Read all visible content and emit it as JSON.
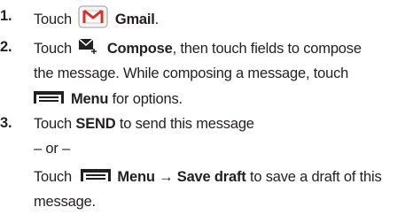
{
  "steps": [
    {
      "number": "1.",
      "text_before": "Touch",
      "bold": "Gmail",
      "text_after": "."
    },
    {
      "number": "2.",
      "line1_before": "Touch",
      "line1_bold": "Compose",
      "line1_after": ", then touch fields to compose",
      "line2": "the message. While composing a message, touch",
      "line3_bold": "Menu",
      "line3_after": "for options."
    },
    {
      "number": "3.",
      "line1_before": "Touch",
      "line1_bold": "SEND",
      "line1_after": "to send this message",
      "line2": "– or –",
      "line3_before": "Touch",
      "line3_bold": "Menu → Save draft",
      "line3_after": "to save a draft of this",
      "line4": "message."
    }
  ],
  "icons": {
    "gmail": "gmail-icon",
    "compose": "compose-icon",
    "menu": "menu-icon",
    "gmail_red": "#d93025"
  }
}
